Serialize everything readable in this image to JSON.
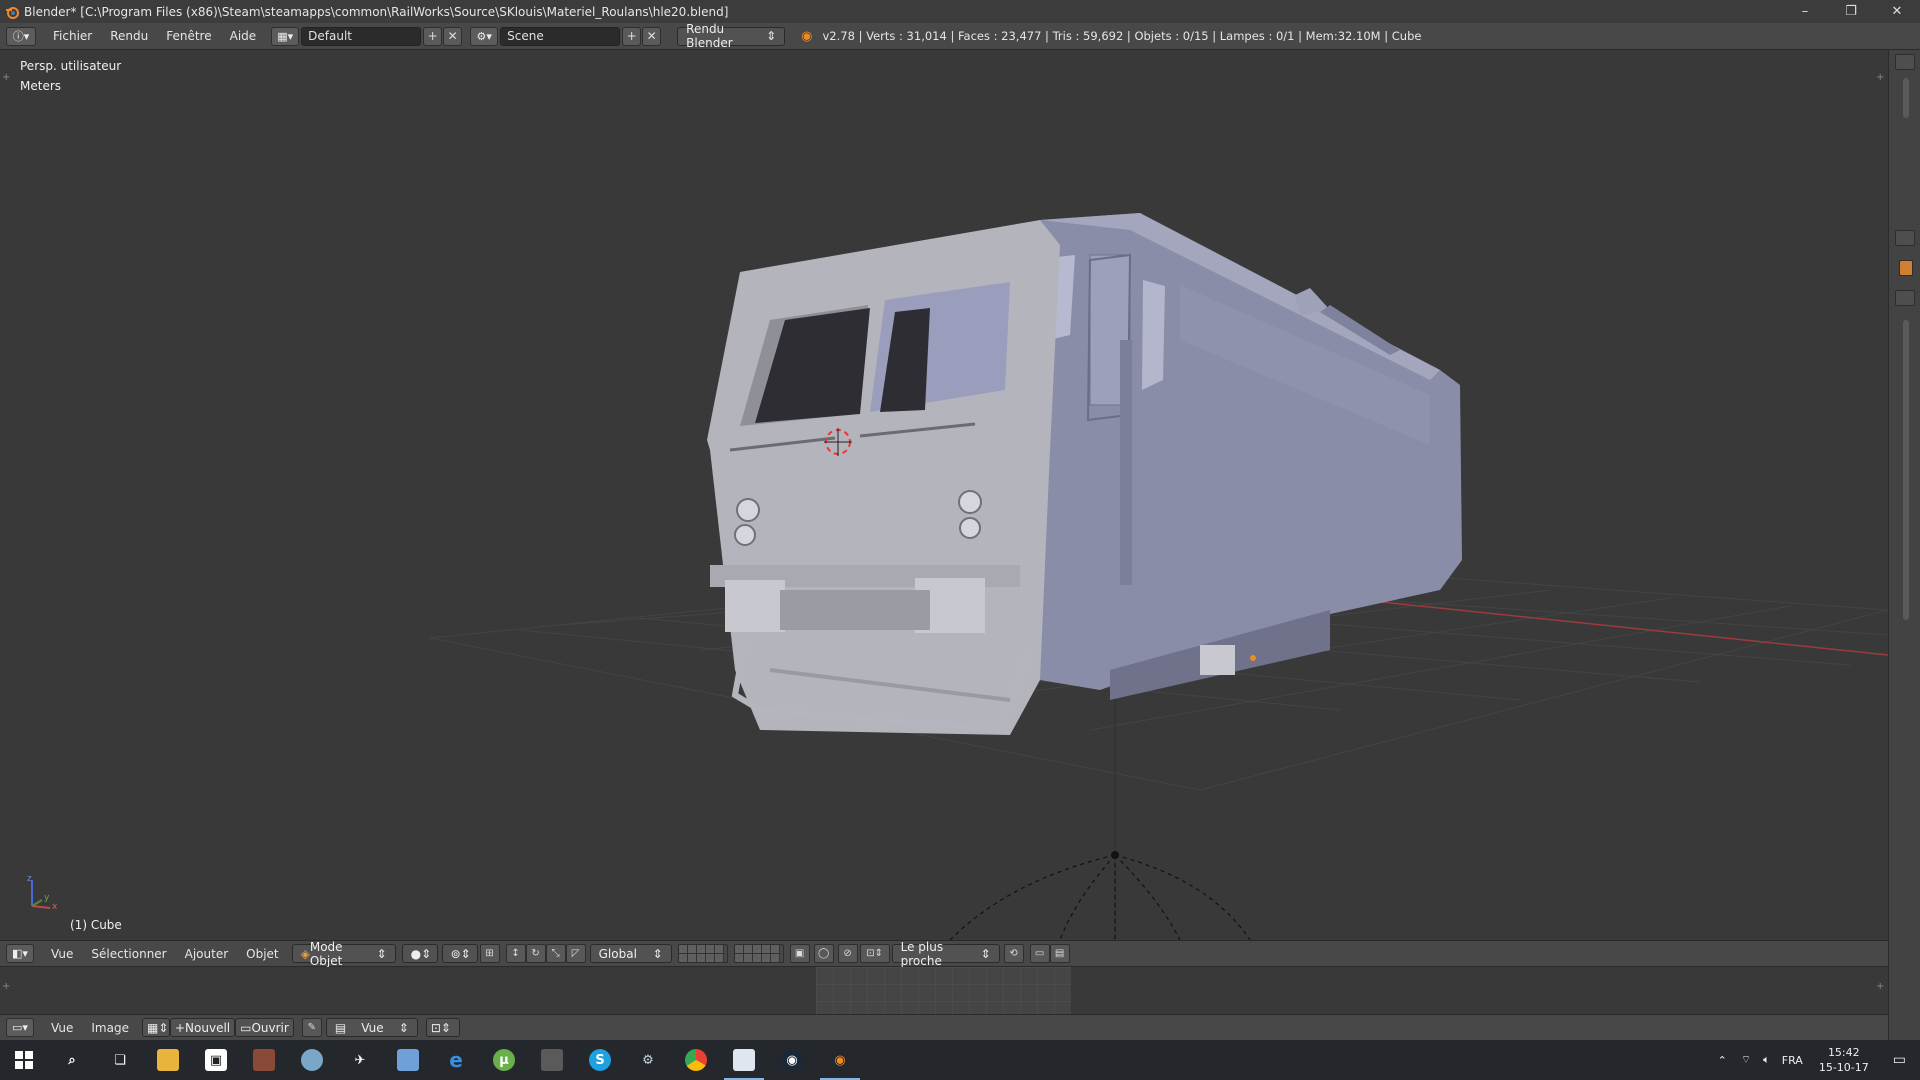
{
  "window": {
    "title": "Blender* [C:\\Program Files (x86)\\Steam\\steamapps\\common\\RailWorks\\Source\\SKlouis\\Materiel_Roulans\\hle20.blend]",
    "minimize": "–",
    "restore": "❐",
    "close": "✕"
  },
  "info_header": {
    "menus": [
      "Fichier",
      "Rendu",
      "Fenêtre",
      "Aide"
    ],
    "screen_layout": "Default",
    "scene": "Scene",
    "render_engine": "Rendu Blender",
    "stats": "v2.78 | Verts : 31,014 | Faces : 23,477 | Tris : 59,692 | Objets : 0/15 | Lampes : 0/1 | Mem:32.10M | Cube"
  },
  "viewport": {
    "view_name": "Persp. utilisateur",
    "units": "Meters",
    "active_object": "(1) Cube",
    "axis_x": "x",
    "axis_y": "y",
    "axis_z": "z"
  },
  "view3d_header": {
    "menus": [
      "Vue",
      "Sélectionner",
      "Ajouter",
      "Objet"
    ],
    "mode": "Mode Objet",
    "orientation": "Global",
    "snap_target": "Le plus proche"
  },
  "image_header": {
    "menus": [
      "Vue",
      "Image"
    ],
    "new_label": "Nouvell",
    "open_label": "Ouvrir",
    "view_label": "Vue"
  },
  "taskbar": {
    "language": "FRA",
    "time": "15:42",
    "date": "15-10-17"
  },
  "colors": {
    "model_body": "#8a8da8",
    "model_front": "#b4b4bc",
    "grid": "#454545",
    "axis_red": "#9b3b3b",
    "axis_green": "#4f8c3a"
  }
}
